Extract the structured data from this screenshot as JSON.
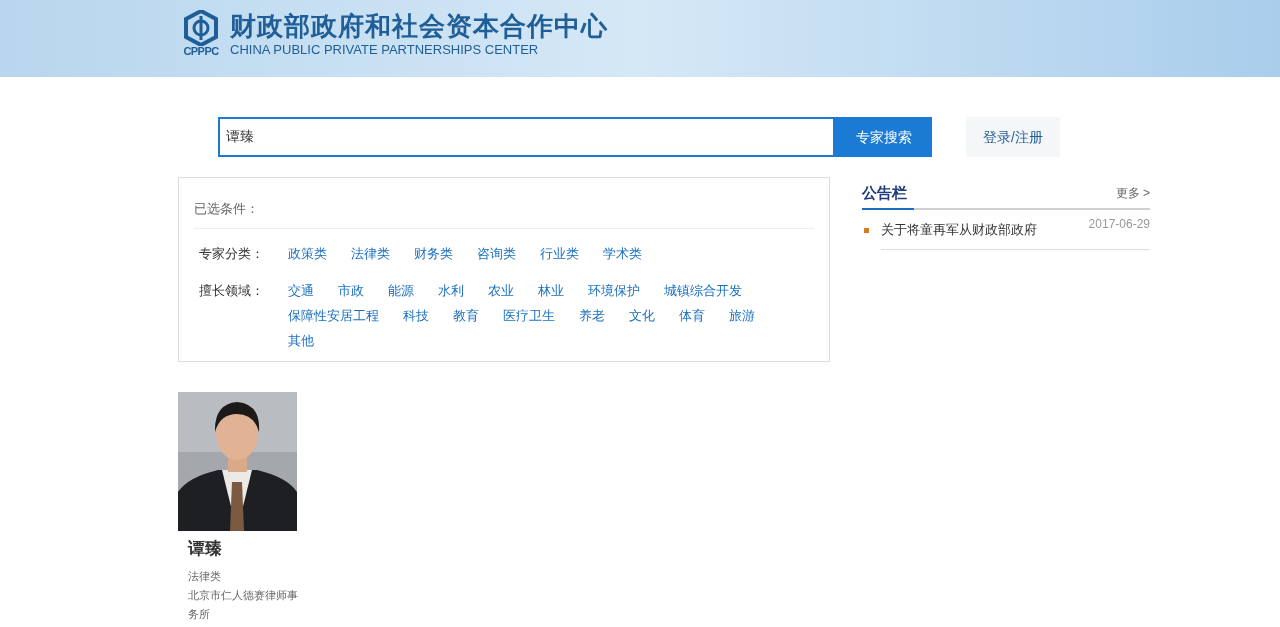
{
  "header": {
    "logo_abbr": "CPPPC",
    "title": "财政部政府和社会资本合作中心",
    "subtitle": "CHINA PUBLIC PRIVATE PARTNERSHIPS CENTER"
  },
  "search": {
    "value": "谭臻",
    "button": "专家搜索",
    "login": "登录/注册"
  },
  "filters": {
    "selected_label": "已选条件：",
    "groups": [
      {
        "label": "专家分类：",
        "options": [
          "政策类",
          "法律类",
          "财务类",
          "咨询类",
          "行业类",
          "学术类"
        ]
      },
      {
        "label": "擅长领域：",
        "options": [
          "交通",
          "市政",
          "能源",
          "水利",
          "农业",
          "林业",
          "环境保护",
          "城镇综合开发",
          "保障性安居工程",
          "科技",
          "教育",
          "医疗卫生",
          "养老",
          "文化",
          "体育",
          "旅游",
          "其他"
        ]
      }
    ]
  },
  "experts": [
    {
      "name": "谭臻",
      "category": "法律类",
      "organization": "北京市仁人德赛律师事务所"
    }
  ],
  "notice": {
    "title": "公告栏",
    "more": "更多 >",
    "items": [
      {
        "text": "关于将童再军从财政部政府",
        "date": "2017-06-29"
      }
    ]
  }
}
